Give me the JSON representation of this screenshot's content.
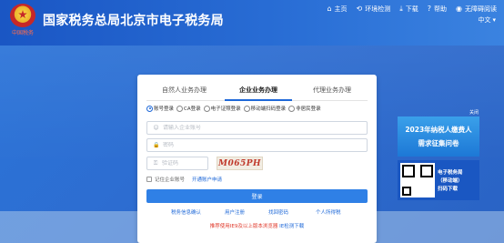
{
  "header": {
    "emblem_caption": "中国税务",
    "site_title": "国家税务总局北京市电子税务局",
    "nav": [
      {
        "icon": "home-icon",
        "glyph": "⌂",
        "label": "主页"
      },
      {
        "icon": "detect-icon",
        "glyph": "⟲",
        "label": "环境检测"
      },
      {
        "icon": "download-icon",
        "glyph": "⤓",
        "label": "下载"
      },
      {
        "icon": "help-icon",
        "glyph": "?",
        "label": "帮助"
      },
      {
        "icon": "eye-icon",
        "glyph": "◉",
        "label": "无障碍阅读"
      }
    ],
    "language": "中文",
    "language_caret": "▾"
  },
  "login": {
    "tabs": [
      "自然人业务办理",
      "企业业务办理",
      "代理业务办理"
    ],
    "active_tab": 1,
    "methods": [
      {
        "label": "账号登录",
        "checked": true
      },
      {
        "label": "CA登录",
        "checked": false
      },
      {
        "label": "电子证照登录",
        "checked": false
      },
      {
        "label": "移动端扫码登录",
        "checked": false
      },
      {
        "label": "非居民登录",
        "checked": false
      }
    ],
    "account_placeholder": "请输入企业账号",
    "account_icon_glyph": "☺",
    "password_placeholder": "密码",
    "password_icon_glyph": "🔒",
    "captcha_placeholder": "验证码",
    "captcha_icon_glyph": "⚿",
    "captcha_text": "M065PH",
    "remember_label": "记住企业账号",
    "open_account_link": "开通账户申请",
    "login_button": "登录",
    "links": [
      "税务信息确认",
      "用户注册",
      "找回密码",
      "个人所得税"
    ],
    "recommend_text": "推荐使用IE9及以上版本浏览器 ",
    "recommend_link": "IE检测下载"
  },
  "side_banner": {
    "close_label": "关闭",
    "line1": "2023年纳税人缴费人",
    "line2": "需求征集问卷",
    "qr_line1": "电子税务局",
    "qr_line2": "（移动端）",
    "qr_line3": "扫码下载"
  }
}
